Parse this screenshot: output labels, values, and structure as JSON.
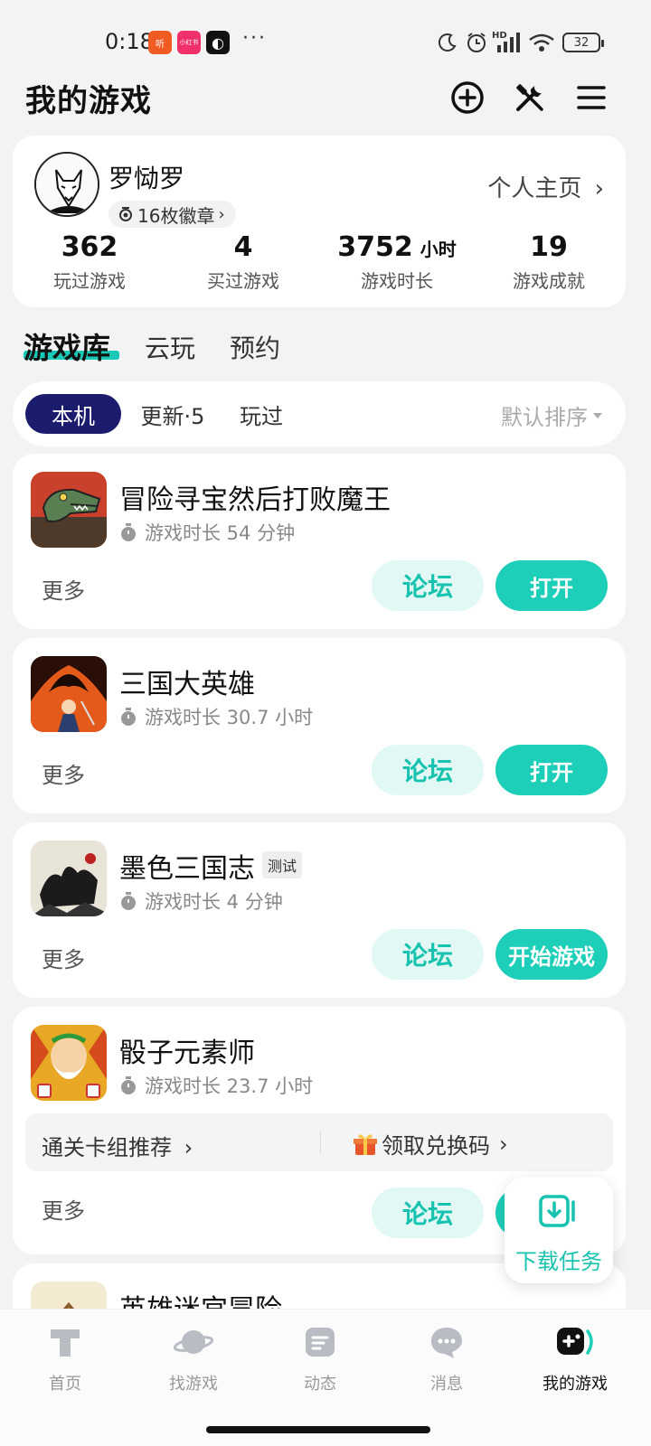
{
  "status_bar": {
    "time": "0:18",
    "app_badges": [
      "听",
      "小红书",
      "◐"
    ],
    "more_dots": "···",
    "network": "HD",
    "battery": "32"
  },
  "header": {
    "title": "我的游戏"
  },
  "profile": {
    "name": "罗恸罗",
    "badges": "16枚徽章",
    "link": "个人主页",
    "stats": [
      {
        "value": "362",
        "unit": "",
        "label": "玩过游戏"
      },
      {
        "value": "4",
        "unit": "",
        "label": "买过游戏"
      },
      {
        "value": "3752",
        "unit": "小时",
        "label": "游戏时长"
      },
      {
        "value": "19",
        "unit": "",
        "label": "游戏成就"
      }
    ]
  },
  "library_tabs": [
    {
      "label": "游戏库",
      "active": true
    },
    {
      "label": "云玩",
      "active": false
    },
    {
      "label": "预约",
      "active": false
    }
  ],
  "filters": {
    "items": [
      "本机",
      "更新·5",
      "玩过"
    ],
    "active_index": 0,
    "sort": "默认排序"
  },
  "games": [
    {
      "name": "冒险寻宝然后打败魔王",
      "tag": "",
      "playtime": "游戏时长 54 分钟",
      "more": "更多",
      "forum": "论坛",
      "action": "打开"
    },
    {
      "name": "三国大英雄",
      "tag": "",
      "playtime": "游戏时长 30.7 小时",
      "more": "更多",
      "forum": "论坛",
      "action": "打开"
    },
    {
      "name": "墨色三国志",
      "tag": "测试",
      "playtime": "游戏时长 4 分钟",
      "more": "更多",
      "forum": "论坛",
      "action": "开始游戏"
    },
    {
      "name": "骰子元素师",
      "tag": "",
      "playtime": "游戏时长 23.7 小时",
      "more": "更多",
      "forum": "论坛",
      "action": "",
      "promos": [
        "通关卡组推荐",
        "领取兑换码"
      ]
    },
    {
      "name": "英雄迷宫冒险",
      "tag": "",
      "playtime": "",
      "more": "",
      "forum": "",
      "action": ""
    }
  ],
  "fab": {
    "label": "下载任务"
  },
  "bottom_nav": [
    {
      "label": "首页",
      "icon": "home-icon",
      "active": false
    },
    {
      "label": "找游戏",
      "icon": "planet-icon",
      "active": false
    },
    {
      "label": "动态",
      "icon": "feed-icon",
      "active": false
    },
    {
      "label": "消息",
      "icon": "message-icon",
      "active": false
    },
    {
      "label": "我的游戏",
      "icon": "gamepad-icon",
      "active": true
    }
  ],
  "colors": {
    "accent": "#1dcfb8",
    "accent_light": "#e2f8f5",
    "filter_active": "#1c1c6e",
    "background": "#f2f3f5"
  }
}
